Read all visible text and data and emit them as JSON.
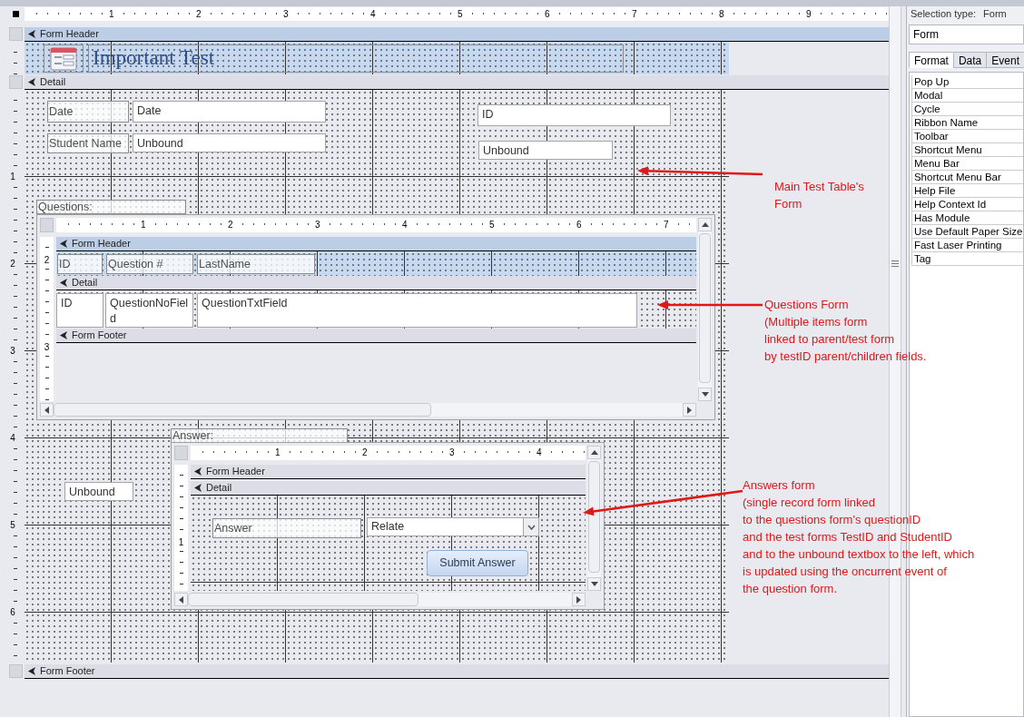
{
  "designer": {
    "ruler": [
      "1",
      "2",
      "3",
      "4",
      "5",
      "6",
      "7",
      "8",
      "9"
    ],
    "vertical_ruler": [
      "1",
      "2",
      "3",
      "4",
      "5",
      "6"
    ],
    "header": {
      "title": "Form Header",
      "selected": true,
      "controls": [
        {
          "kind": "logo"
        },
        {
          "kind": "title",
          "text": "Important Test"
        }
      ]
    },
    "detail": {
      "title": "Detail",
      "selected": false,
      "controls": [
        {
          "kind": "label",
          "text": "Date"
        },
        {
          "kind": "textbox",
          "text": "Date"
        },
        {
          "kind": "label",
          "text": "Student Name"
        },
        {
          "kind": "textbox",
          "text": "Unbound"
        },
        {
          "kind": "textbox",
          "text": "ID"
        },
        {
          "kind": "textbox",
          "text": "Unbound"
        },
        {
          "kind": "label",
          "text": "Questions:"
        },
        {
          "kind": "subform",
          "ruler": [
            "1",
            "2",
            "3",
            "4",
            "5",
            "6",
            "7"
          ],
          "vertical_ruler": [
            "2",
            "3"
          ],
          "sections": [
            {
              "title": "Form Header",
              "selected": true,
              "controls": [
                {
                  "kind": "label",
                  "text": "ID"
                },
                {
                  "kind": "label",
                  "text": "Question #"
                },
                {
                  "kind": "label",
                  "text": "LastName"
                }
              ]
            },
            {
              "title": "Detail",
              "selected": false,
              "controls": [
                {
                  "kind": "textbox",
                  "text": "ID"
                },
                {
                  "kind": "textbox",
                  "text": "QuestionNoField"
                },
                {
                  "kind": "textbox",
                  "text": "QuestionTxtField"
                }
              ]
            },
            {
              "title": "Form Footer",
              "selected": false
            }
          ]
        },
        {
          "kind": "label",
          "text": "Answer:"
        },
        {
          "kind": "subform",
          "ruler": [
            "1",
            "2",
            "3",
            "4"
          ],
          "vertical_ruler": [
            "1"
          ],
          "sections": [
            {
              "title": "Form Header",
              "selected": false
            },
            {
              "title": "Detail",
              "selected": false,
              "controls": [
                {
                  "kind": "label",
                  "text": "Answer"
                },
                {
                  "kind": "combobox",
                  "text": "Relate"
                },
                {
                  "kind": "button",
                  "text": "Submit Answer"
                }
              ]
            }
          ]
        },
        {
          "kind": "textbox",
          "text": "Unbound"
        }
      ]
    },
    "footer": {
      "title": "Form Footer",
      "selected": false
    }
  },
  "annotations": [
    {
      "text": "Main Test Table's\nForm"
    },
    {
      "text": "Questions Form\n(Multiple items form\nlinked to parent/test form\nby testID parent/children fields."
    },
    {
      "text": "Answers form\n(single record form linked\nto the questions form's questionID\nand the test forms TestID and StudentID\nand to the unbound textbox to the left, which\nis updated using the oncurrent event of\nthe question form."
    }
  ],
  "property_sheet": {
    "selection_label": "Selection type:",
    "selection_type": "Form",
    "object": "Form",
    "tabs": [
      {
        "label": "Format",
        "selected": true
      },
      {
        "label": "Data",
        "selected": false
      },
      {
        "label": "Event",
        "selected": false
      }
    ],
    "properties": [
      "Pop Up",
      "Modal",
      "Cycle",
      "Ribbon Name",
      "Toolbar",
      "Shortcut Menu",
      "Menu Bar",
      "Shortcut Menu Bar",
      "Help File",
      "Help Context Id",
      "Has Module",
      "Use Default Paper Size",
      "Fast Laser Printing",
      "Tag"
    ]
  }
}
